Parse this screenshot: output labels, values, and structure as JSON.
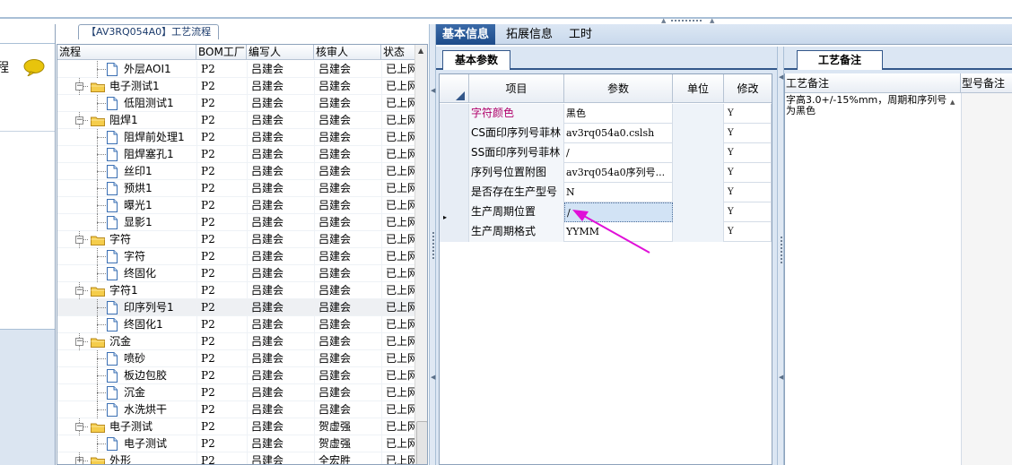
{
  "tree_panel": {
    "title": "【AV3RQ054A0】工艺流程",
    "columns": [
      "流程",
      "BOM工厂",
      "编写人",
      "核审人",
      "状态"
    ],
    "rows": [
      {
        "name": "外层AOI1",
        "level": 2,
        "kind": "file",
        "bom": "P2",
        "editor": "吕建会",
        "auditor": "吕建会",
        "status": "已上网",
        "expander": ""
      },
      {
        "name": "电子测试1",
        "level": 1,
        "kind": "folder",
        "bom": "P2",
        "editor": "吕建会",
        "auditor": "吕建会",
        "status": "已上网",
        "expander": "−"
      },
      {
        "name": "低阻测试1",
        "level": 2,
        "kind": "file",
        "bom": "P2",
        "editor": "吕建会",
        "auditor": "吕建会",
        "status": "已上网",
        "expander": ""
      },
      {
        "name": "阻焊1",
        "level": 1,
        "kind": "folder",
        "bom": "P2",
        "editor": "吕建会",
        "auditor": "吕建会",
        "status": "已上网",
        "expander": "−"
      },
      {
        "name": "阻焊前处理1",
        "level": 2,
        "kind": "file",
        "bom": "P2",
        "editor": "吕建会",
        "auditor": "吕建会",
        "status": "已上网",
        "expander": ""
      },
      {
        "name": "阻焊塞孔1",
        "level": 2,
        "kind": "file",
        "bom": "P2",
        "editor": "吕建会",
        "auditor": "吕建会",
        "status": "已上网",
        "expander": ""
      },
      {
        "name": "丝印1",
        "level": 2,
        "kind": "file",
        "bom": "P2",
        "editor": "吕建会",
        "auditor": "吕建会",
        "status": "已上网",
        "expander": ""
      },
      {
        "name": "预烘1",
        "level": 2,
        "kind": "file",
        "bom": "P2",
        "editor": "吕建会",
        "auditor": "吕建会",
        "status": "已上网",
        "expander": ""
      },
      {
        "name": "曝光1",
        "level": 2,
        "kind": "file",
        "bom": "P2",
        "editor": "吕建会",
        "auditor": "吕建会",
        "status": "已上网",
        "expander": ""
      },
      {
        "name": "显影1",
        "level": 2,
        "kind": "file",
        "bom": "P2",
        "editor": "吕建会",
        "auditor": "吕建会",
        "status": "已上网",
        "expander": ""
      },
      {
        "name": "字符",
        "level": 1,
        "kind": "folder",
        "bom": "P2",
        "editor": "吕建会",
        "auditor": "吕建会",
        "status": "已上网",
        "expander": "−"
      },
      {
        "name": "字符",
        "level": 2,
        "kind": "file",
        "bom": "P2",
        "editor": "吕建会",
        "auditor": "吕建会",
        "status": "已上网",
        "expander": ""
      },
      {
        "name": "终固化",
        "level": 2,
        "kind": "file",
        "bom": "P2",
        "editor": "吕建会",
        "auditor": "吕建会",
        "status": "已上网",
        "expander": ""
      },
      {
        "name": "字符1",
        "level": 1,
        "kind": "folder",
        "bom": "P2",
        "editor": "吕建会",
        "auditor": "吕建会",
        "status": "已上网",
        "expander": "−"
      },
      {
        "name": "印序列号1",
        "level": 2,
        "kind": "file",
        "bom": "P2",
        "editor": "吕建会",
        "auditor": "吕建会",
        "status": "已上网",
        "expander": "",
        "selected": true
      },
      {
        "name": "终固化1",
        "level": 2,
        "kind": "file",
        "bom": "P2",
        "editor": "吕建会",
        "auditor": "吕建会",
        "status": "已上网",
        "expander": ""
      },
      {
        "name": "沉金",
        "level": 1,
        "kind": "folder",
        "bom": "P2",
        "editor": "吕建会",
        "auditor": "吕建会",
        "status": "已上网",
        "expander": "−"
      },
      {
        "name": "喷砂",
        "level": 2,
        "kind": "file",
        "bom": "P2",
        "editor": "吕建会",
        "auditor": "吕建会",
        "status": "已上网",
        "expander": ""
      },
      {
        "name": "板边包胶",
        "level": 2,
        "kind": "file",
        "bom": "P2",
        "editor": "吕建会",
        "auditor": "吕建会",
        "status": "已上网",
        "expander": ""
      },
      {
        "name": "沉金",
        "level": 2,
        "kind": "file",
        "bom": "P2",
        "editor": "吕建会",
        "auditor": "吕建会",
        "status": "已上网",
        "expander": ""
      },
      {
        "name": "水洗烘干",
        "level": 2,
        "kind": "file",
        "bom": "P2",
        "editor": "吕建会",
        "auditor": "吕建会",
        "status": "已上网",
        "expander": ""
      },
      {
        "name": "电子测试",
        "level": 1,
        "kind": "folder",
        "bom": "P2",
        "editor": "吕建会",
        "auditor": "贺虚强",
        "status": "已上网",
        "expander": "−"
      },
      {
        "name": "电子测试",
        "level": 2,
        "kind": "file",
        "bom": "P2",
        "editor": "吕建会",
        "auditor": "贺虚强",
        "status": "已上网",
        "expander": ""
      },
      {
        "name": "外形",
        "level": 1,
        "kind": "folder",
        "bom": "P2",
        "editor": "吕建会",
        "auditor": "全宏胜",
        "status": "已上网",
        "expander": "+"
      }
    ]
  },
  "main_tabs": [
    "基本信息",
    "拓展信息",
    "工时"
  ],
  "params_panel": {
    "tab_label": "基本参数",
    "columns": [
      "项目",
      "参数",
      "单位",
      "修改"
    ],
    "rows": [
      {
        "name": "字符颜色",
        "value": "黑色",
        "unit": "",
        "mod": "Y",
        "highlight": true
      },
      {
        "name": "CS面印序列号菲林",
        "value": "av3rq054a0.cslsh",
        "unit": "",
        "mod": "Y"
      },
      {
        "name": "SS面印序列号菲林",
        "value": "/",
        "unit": "",
        "mod": "Y"
      },
      {
        "name": "序列号位置附图",
        "value": "av3rq054a0序列号...",
        "unit": "",
        "mod": "Y"
      },
      {
        "name": "是否存在生产型号",
        "value": "N",
        "unit": "",
        "mod": "Y"
      },
      {
        "name": "生产周期位置",
        "value": "/",
        "unit": "",
        "mod": "Y",
        "current": true
      },
      {
        "name": "生产周期格式",
        "value": "YYMM",
        "unit": "",
        "mod": "Y"
      }
    ],
    "row_pointer": "▸"
  },
  "remark_panel": {
    "tab_label": "工艺备注",
    "columns": [
      "工艺备注",
      "型号备注"
    ],
    "remark_text": "字高3.0+/-15%mm，周期和序列号为黑色"
  },
  "colors": {
    "accent": "#1d4b8a",
    "highlight_text": "#b0006a",
    "arrow": "#e010d8"
  },
  "icons": [
    "chat-bubble-icon",
    "folder-icon",
    "file-icon",
    "corner-triangle-icon",
    "pink-arrow-icon"
  ]
}
